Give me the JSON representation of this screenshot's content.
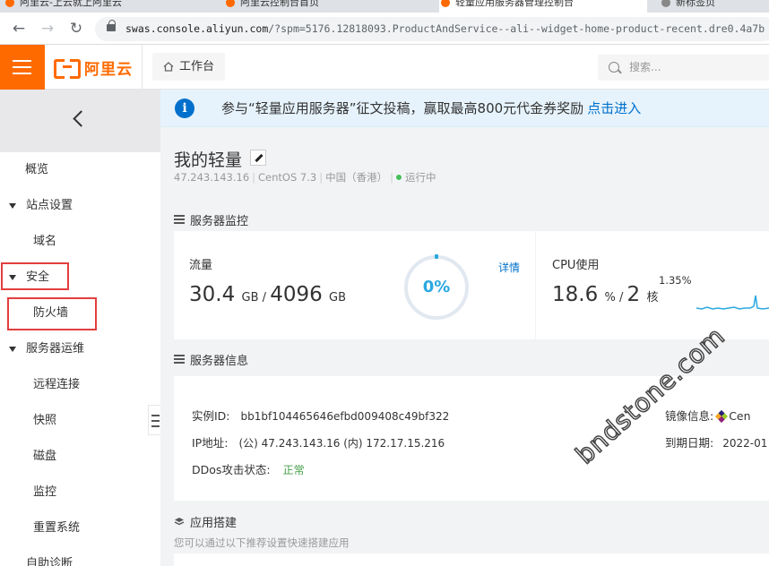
{
  "browser": {
    "tabs": [
      {
        "label": "阿里云-上云就上阿里云"
      },
      {
        "label": "阿里云控制台首页"
      },
      {
        "label": "轻量应用服务器管理控制台"
      },
      {
        "label": "新标签页"
      }
    ],
    "url_host": "swas.console.aliyun.com",
    "url_rest": "/?spm=5176.12818093.ProductAndService--ali--widget-home-product-recent.dre0.4a7b"
  },
  "header": {
    "logo_text": "阿里云",
    "workbench_label": "工作台",
    "search_placeholder": "搜索..."
  },
  "sidebar": {
    "items": [
      {
        "label": "概览"
      },
      {
        "label": "站点设置"
      },
      {
        "label": "域名"
      },
      {
        "label": "安全"
      },
      {
        "label": "防火墙"
      },
      {
        "label": "服务器运维"
      },
      {
        "label": "远程连接"
      },
      {
        "label": "快照"
      },
      {
        "label": "磁盘"
      },
      {
        "label": "监控"
      },
      {
        "label": "重置系统"
      },
      {
        "label": "自助诊断"
      }
    ]
  },
  "banner": {
    "message": "参与“轻量应用服务器”征文投稿，赢取最高800元代金券奖励",
    "link_text": "点击进入"
  },
  "server": {
    "title": "我的轻量",
    "ip": "47.243.143.16",
    "os": "CentOS 7.3",
    "region": "中国（香港）",
    "status": "运行中"
  },
  "monitor": {
    "section_title": "服务器监控",
    "traffic_label": "流量",
    "traffic_used": "30.4",
    "traffic_total": "4096",
    "traffic_unit": "GB",
    "traffic_percent": "0%",
    "detail_link": "详情",
    "cpu_label": "CPU使用",
    "cpu_value": "18.6",
    "cpu_unit": "%",
    "cpu_cores": "2",
    "cpu_cores_unit": "核",
    "cpu_peak": "1.35%"
  },
  "info": {
    "section_title": "服务器信息",
    "instance_id_label": "实例ID:",
    "instance_id": "bb1bf104465646efbd009408c49bf322",
    "ip_label": "IP地址:",
    "ip_value": "(公) 47.243.143.16 (内) 172.17.15.216",
    "ddos_label": "DDos攻击状态:",
    "ddos_value": "正常",
    "image_label": "镜像信息:",
    "image_value": "Cen",
    "expire_label": "到期日期:",
    "expire_value": "2022-01"
  },
  "app": {
    "section_title": "应用搭建",
    "desc": "您可以通过以下推荐设置快速搭建应用"
  },
  "watermark": "bndstone.com",
  "colors": {
    "brand_orange": "#ff6a00",
    "link_blue": "#0070cc",
    "gauge_blue": "#2aa8e0",
    "status_green": "#44c05a",
    "highlight_red": "#e33e3e"
  }
}
